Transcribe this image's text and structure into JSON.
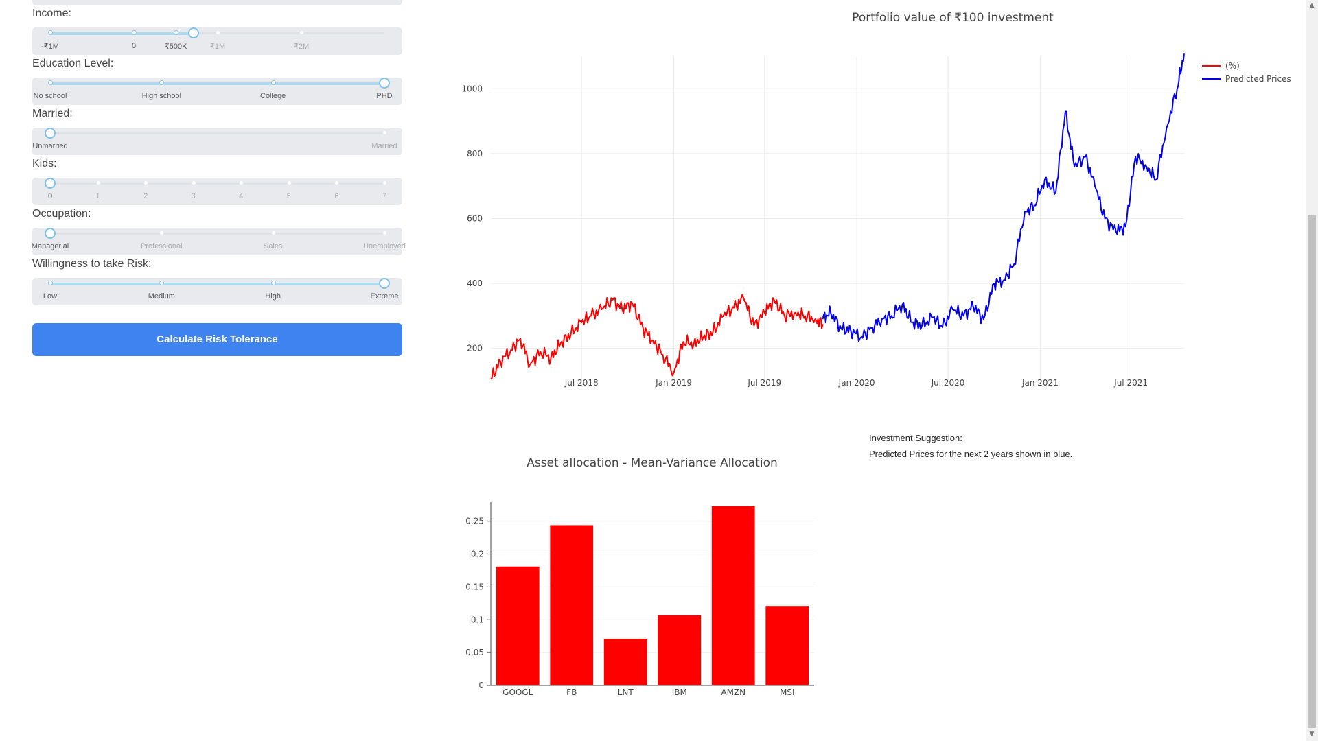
{
  "form": {
    "income": {
      "label": "Income:",
      "ticks": [
        "-₹1M",
        "0",
        "₹500K",
        "₹1M",
        "₹2M"
      ],
      "value_fraction": 0.43
    },
    "education": {
      "label": "Education Level:",
      "ticks": [
        "No school",
        "High school",
        "College",
        "PHD"
      ],
      "value_index": 3
    },
    "married": {
      "label": "Married:",
      "ticks": [
        "Unmarried",
        "Married"
      ],
      "value_index": 0
    },
    "kids": {
      "label": "Kids:",
      "ticks": [
        "0",
        "1",
        "2",
        "3",
        "4",
        "5",
        "6",
        "7"
      ],
      "value_index": 0
    },
    "occupation": {
      "label": "Occupation:",
      "ticks": [
        "Managerial",
        "Professional",
        "Sales",
        "Unemployed"
      ],
      "value_index": 0
    },
    "risk": {
      "label": "Willingness to take Risk:",
      "ticks": [
        "Low",
        "Medium",
        "High",
        "Extreme"
      ],
      "value_index": 3
    },
    "button_label": "Calculate Risk Tolerance",
    "accent_color": "#3f83f0"
  },
  "suggestion": {
    "heading": "Investment Suggestion:",
    "text": "Predicted Prices for the next 2 years shown in blue."
  },
  "chart_data": [
    {
      "type": "line",
      "title": "Portfolio value of ₹100 investment",
      "x_range": [
        "2018-01-01",
        "2021-10-15"
      ],
      "y_range": [
        100,
        1100
      ],
      "y_ticks": [
        200,
        400,
        600,
        800,
        1000
      ],
      "x_ticks": [
        {
          "date": "2018-07-01",
          "label": "Jul 2018"
        },
        {
          "date": "2019-01-01",
          "label": "Jan 2019"
        },
        {
          "date": "2019-07-01",
          "label": "Jul 2019"
        },
        {
          "date": "2020-01-01",
          "label": "Jan 2020"
        },
        {
          "date": "2020-07-01",
          "label": "Jul 2020"
        },
        {
          "date": "2021-01-01",
          "label": "Jan 2021"
        },
        {
          "date": "2021-07-01",
          "label": "Jul 2021"
        }
      ],
      "legend_position": "top-right",
      "grid": true,
      "series": [
        {
          "name": "(%)",
          "color": "#ff0000",
          "x": [
            "2018-01-01",
            "2018-01-20",
            "2018-02-10",
            "2018-03-01",
            "2018-03-20",
            "2018-04-10",
            "2018-05-01",
            "2018-05-20",
            "2018-06-10",
            "2018-07-01",
            "2018-07-20",
            "2018-08-10",
            "2018-09-01",
            "2018-09-20",
            "2018-10-10",
            "2018-11-01",
            "2018-11-20",
            "2018-12-10",
            "2019-01-01",
            "2019-01-20",
            "2019-02-10",
            "2019-03-01",
            "2019-03-20",
            "2019-04-10",
            "2019-05-01",
            "2019-05-20",
            "2019-06-10",
            "2019-07-01",
            "2019-07-20",
            "2019-08-10",
            "2019-09-01",
            "2019-09-20",
            "2019-10-10",
            "2019-10-25"
          ],
          "y": [
            105,
            160,
            195,
            230,
            150,
            190,
            170,
            215,
            245,
            280,
            300,
            320,
            350,
            320,
            340,
            260,
            225,
            180,
            125,
            220,
            215,
            235,
            250,
            300,
            325,
            355,
            270,
            310,
            350,
            300,
            310,
            300,
            290,
            275
          ]
        },
        {
          "name": "Predicted Prices",
          "color": "#0000ee",
          "x": [
            "2019-10-25",
            "2019-11-10",
            "2019-12-01",
            "2019-12-20",
            "2020-01-10",
            "2020-02-01",
            "2020-02-20",
            "2020-03-10",
            "2020-04-01",
            "2020-04-20",
            "2020-05-10",
            "2020-06-01",
            "2020-06-20",
            "2020-07-10",
            "2020-08-01",
            "2020-08-20",
            "2020-09-10",
            "2020-10-01",
            "2020-10-20",
            "2020-11-10",
            "2020-12-01",
            "2020-12-20",
            "2021-01-10",
            "2021-02-01",
            "2021-02-20",
            "2021-03-10",
            "2021-04-01",
            "2021-04-20",
            "2021-05-10",
            "2021-06-01",
            "2021-06-20",
            "2021-07-10",
            "2021-08-01",
            "2021-08-20",
            "2021-09-10",
            "2021-10-01",
            "2021-10-15"
          ],
          "y": [
            290,
            310,
            260,
            255,
            235,
            265,
            290,
            300,
            335,
            280,
            270,
            295,
            265,
            320,
            300,
            330,
            290,
            400,
            410,
            460,
            620,
            640,
            720,
            680,
            930,
            760,
            790,
            700,
            600,
            560,
            575,
            790,
            760,
            720,
            880,
            1000,
            1110
          ]
        }
      ]
    },
    {
      "type": "bar",
      "title": "Asset allocation - Mean-Variance Allocation",
      "categories": [
        "GOOGL",
        "FB",
        "LNT",
        "IBM",
        "AMZN",
        "MSI"
      ],
      "values": [
        0.181,
        0.244,
        0.071,
        0.107,
        0.273,
        0.121
      ],
      "ylim": [
        0,
        0.28
      ],
      "y_ticks": [
        0,
        0.05,
        0.1,
        0.15,
        0.2,
        0.25
      ],
      "color": "#ff0000"
    }
  ]
}
